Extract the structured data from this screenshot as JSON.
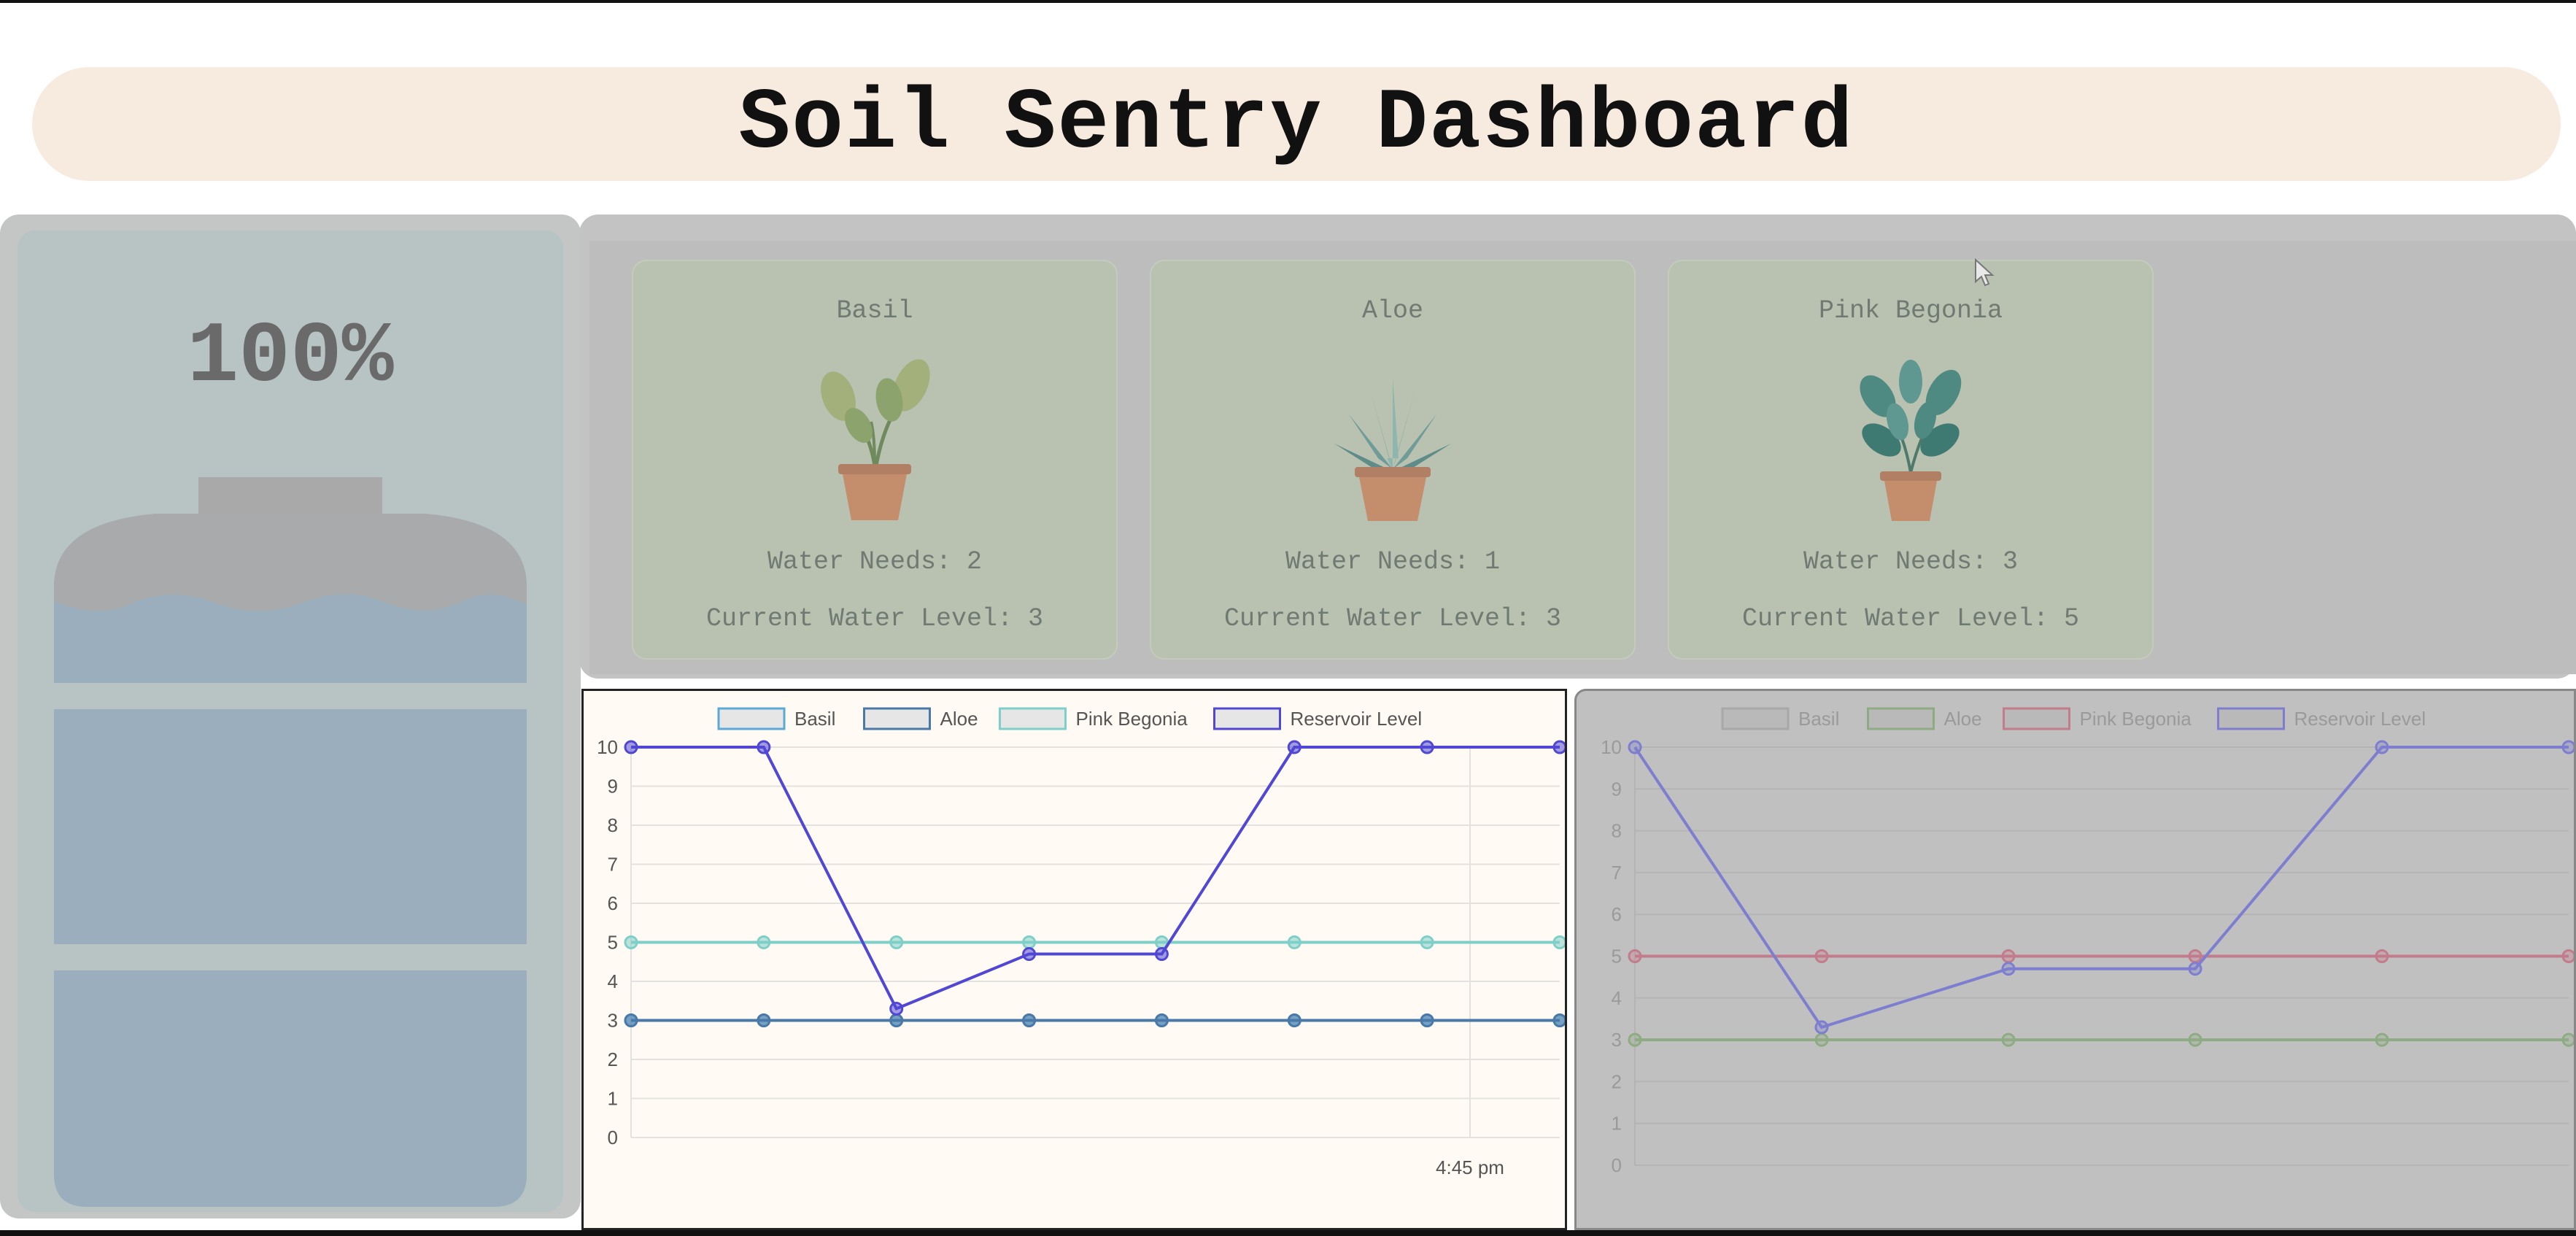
{
  "header": {
    "title": "Soil Sentry Dashboard"
  },
  "reservoir": {
    "percent_label": "100%",
    "fill_fraction": 1.0
  },
  "plants": [
    {
      "name": "Basil",
      "icon": "plant-basil-icon",
      "needs_label": "Water Needs: 2",
      "level_label": "Current Water Level: 3"
    },
    {
      "name": "Aloe",
      "icon": "plant-aloe-icon",
      "needs_label": "Water Needs: 1",
      "level_label": "Current Water Level: 3"
    },
    {
      "name": "Pink Begonia",
      "icon": "plant-begonia-icon",
      "needs_label": "Water Needs: 3",
      "level_label": "Current Water Level: 5"
    }
  ],
  "chart_data": [
    {
      "type": "line",
      "legend_position": "top",
      "grid": true,
      "ylim": [
        0,
        10
      ],
      "yticks": [
        0,
        1,
        2,
        3,
        4,
        5,
        6,
        7,
        8,
        9,
        10
      ],
      "x_tick_label": "4:45 pm",
      "series": [
        {
          "name": "Basil",
          "color": "#5aa9d6",
          "values": [
            3,
            3,
            3,
            3,
            3,
            3,
            3,
            3
          ]
        },
        {
          "name": "Aloe",
          "color": "#4a79a8",
          "values": [
            3,
            3,
            3,
            3,
            3,
            3,
            3,
            3
          ]
        },
        {
          "name": "Pink Begonia",
          "color": "#7fcfc9",
          "values": [
            5,
            5,
            5,
            5,
            5,
            5,
            5,
            5
          ]
        },
        {
          "name": "Reservoir Level",
          "color": "#5048d4",
          "values": [
            10,
            10,
            3.3,
            4.7,
            4.7,
            10,
            10,
            10
          ]
        }
      ]
    },
    {
      "type": "line",
      "legend_position": "top",
      "grid": true,
      "ylim": [
        0,
        10
      ],
      "yticks": [
        0,
        1,
        2,
        3,
        4,
        5,
        6,
        7,
        8,
        9,
        10
      ],
      "series": [
        {
          "name": "Basil",
          "color": "#a8a8a8",
          "values": []
        },
        {
          "name": "Aloe",
          "color": "#8fab84",
          "values": [
            3,
            3,
            3,
            3,
            3,
            3
          ]
        },
        {
          "name": "Pink Begonia",
          "color": "#c27c8c",
          "values": [
            5,
            5,
            5,
            5,
            5,
            5
          ]
        },
        {
          "name": "Reservoir Level",
          "color": "#7e7ed0",
          "values": [
            10,
            3.3,
            4.7,
            4.7,
            10,
            10
          ]
        }
      ]
    }
  ]
}
